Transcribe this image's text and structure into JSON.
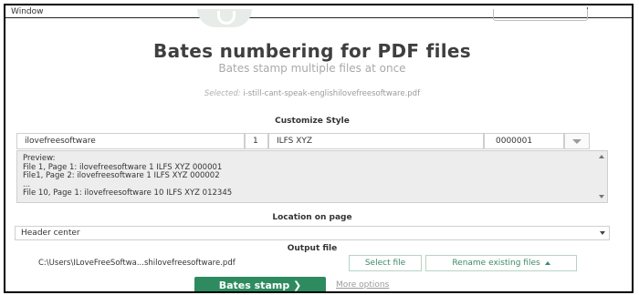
{
  "window": {
    "title": "Window"
  },
  "header": {
    "title": "Bates numbering for PDF files",
    "subtitle": "Bates stamp multiple files at once",
    "selected_label": "Selected:",
    "selected_file": "i-still-cant-speak-englishilovefreesoftware.pdf"
  },
  "style": {
    "section_label": "Customize Style",
    "prefix": "ilovefreesoftware",
    "start_number": "1",
    "suffix": "ILFS XYZ",
    "number_format": "0000001"
  },
  "preview": {
    "label": "Preview:",
    "lines": [
      "File 1, Page 1: ilovefreesoftware 1 ILFS XYZ 000001",
      "File1, Page 2: ilovefreesoftware 1 ILFS XYZ 000002",
      "...",
      "File 10, Page 1: ilovefreesoftware 10 ILFS XYZ 012345"
    ]
  },
  "location": {
    "section_label": "Location on page",
    "selected": "Header center"
  },
  "output": {
    "section_label": "Output file",
    "path": "C:\\Users\\ILoveFreeSoftwa...shilovefreesoftware.pdf",
    "select_file_label": "Select file",
    "rename_label": "Rename existing files"
  },
  "actions": {
    "primary_label": "Bates stamp",
    "primary_arrow": "❯",
    "more_options_label": "More options"
  },
  "colors": {
    "accent": "#2e8b5f",
    "button_text": "#3c8a66"
  }
}
